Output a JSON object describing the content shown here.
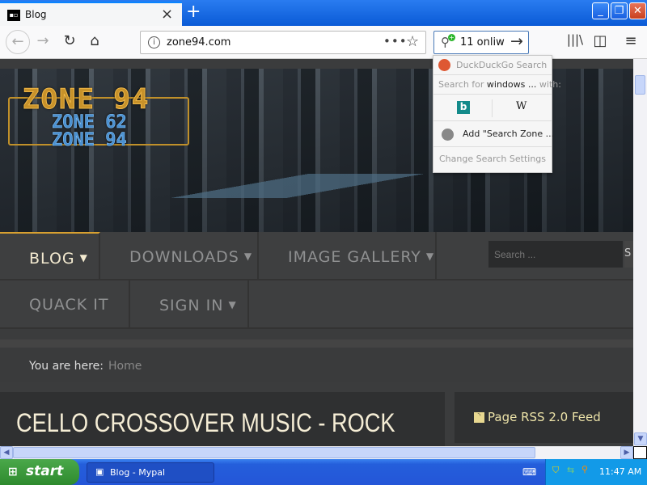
{
  "browser": {
    "tab_title": "Blog",
    "url": "zone94.com",
    "search_value": "11 onliw",
    "new_tab": "+",
    "window_buttons": {
      "minimize": "_",
      "maximize": "❐",
      "close": "✕"
    }
  },
  "search_popup": {
    "engine": "DuckDuckGo Search",
    "search_for_prefix": "Search for ",
    "search_term": "windows ...",
    "search_for_suffix": " with:",
    "alt_engines": [
      "b",
      "W"
    ],
    "add_engine": "Add \"Search Zone ...",
    "settings": "Change Search Settings"
  },
  "site": {
    "logo": "ZONE 94",
    "logo_sub": [
      "ZONE 62",
      "ZONE 94"
    ],
    "nav": [
      {
        "label": "BLOG",
        "dropdown": true,
        "active": true
      },
      {
        "label": "DOWNLOADS",
        "dropdown": true
      },
      {
        "label": "IMAGE GALLERY",
        "dropdown": true
      },
      {
        "label": "QUACK IT",
        "dropdown": false
      },
      {
        "label": "SIGN IN",
        "dropdown": true
      }
    ],
    "search_placeholder": "Search ...",
    "search_button": "S",
    "breadcrumb": {
      "label": "You are here:",
      "home": "Home"
    },
    "article_title": "CELLO CROSSOVER MUSIC - ROCK",
    "rss": "Page RSS 2.0 Feed"
  },
  "taskbar": {
    "start": "start",
    "task": "Blog - Mypal",
    "clock": "11:47 AM"
  },
  "colors": {
    "titlebar": "#0a5ad6",
    "accent_gold": "#d8a030",
    "nav_active": "#f3ead0",
    "rss": "#ece2a8"
  }
}
